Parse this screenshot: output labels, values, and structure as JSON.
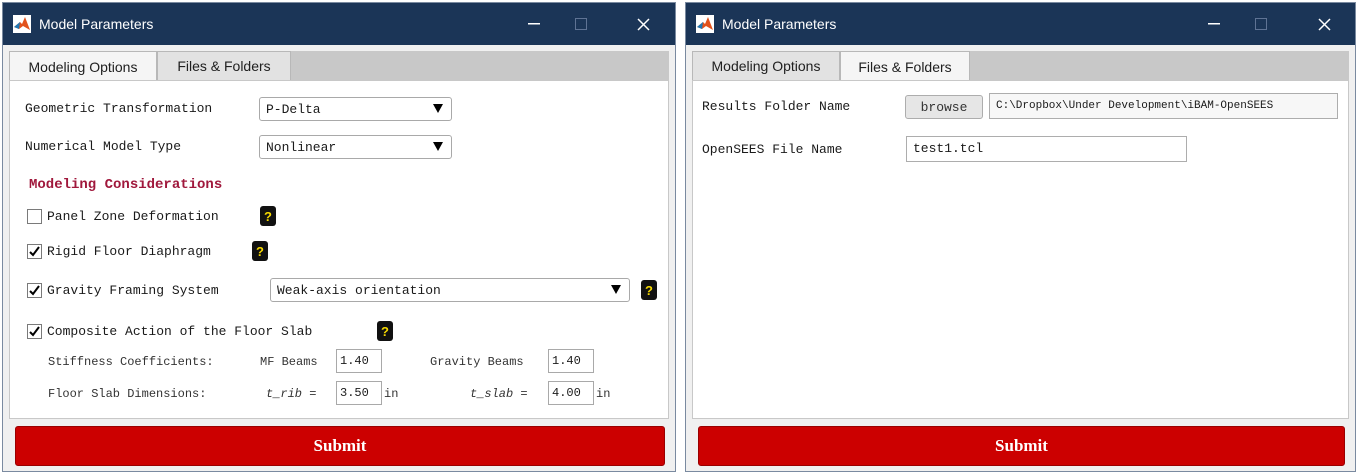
{
  "left_window": {
    "title": "Model Parameters",
    "tabs": [
      {
        "label": "Modeling Options",
        "active": true
      },
      {
        "label": "Files & Folders",
        "active": false
      }
    ],
    "geometric_transformation": {
      "label": "Geometric Transformation",
      "value": "P-Delta"
    },
    "numerical_model_type": {
      "label": "Numerical Model Type",
      "value": "Nonlinear"
    },
    "section_heading": "Modeling Considerations",
    "panel_zone": {
      "label": "Panel Zone Deformation",
      "checked": false
    },
    "rigid_floor": {
      "label": "Rigid Floor Diaphragm",
      "checked": true
    },
    "gravity_framing": {
      "label": "Gravity Framing System",
      "checked": true,
      "option": "Weak-axis orientation"
    },
    "composite_action": {
      "label": "Composite Action of the Floor Slab",
      "checked": true
    },
    "stiffness": {
      "label": "Stiffness Coefficients:",
      "mf_label": "MF Beams",
      "mf_value": "1.40",
      "grav_label": "Gravity Beams",
      "grav_value": "1.40"
    },
    "slab_dims": {
      "label": "Floor Slab Dimensions:",
      "t_rib_label": "t_rib =",
      "t_rib_value": "3.50",
      "t_slab_label": "t_slab =",
      "t_slab_value": "4.00",
      "unit": "in"
    },
    "help_glyph": "?",
    "submit_label": "Submit"
  },
  "right_window": {
    "title": "Model Parameters",
    "tabs": [
      {
        "label": "Modeling Options",
        "active": false
      },
      {
        "label": "Files & Folders",
        "active": true
      }
    ],
    "results_folder": {
      "label": "Results Folder Name",
      "button": "browse",
      "value": "C:\\Dropbox\\Under Development\\iBAM-OpenSEES"
    },
    "opensees_file": {
      "label": "OpenSEES File Name",
      "value": "test1.tcl"
    },
    "submit_label": "Submit"
  },
  "colors": {
    "titlebar": "#1b3557",
    "submit": "#cc0000",
    "heading": "#a0183c",
    "help_bg": "#111111",
    "help_fg": "#f5d800"
  },
  "icons": [
    "matlab-logo-icon",
    "minimize-icon",
    "maximize-icon",
    "close-icon",
    "checkmark-icon",
    "dropdown-arrow-icon",
    "help-icon"
  ]
}
